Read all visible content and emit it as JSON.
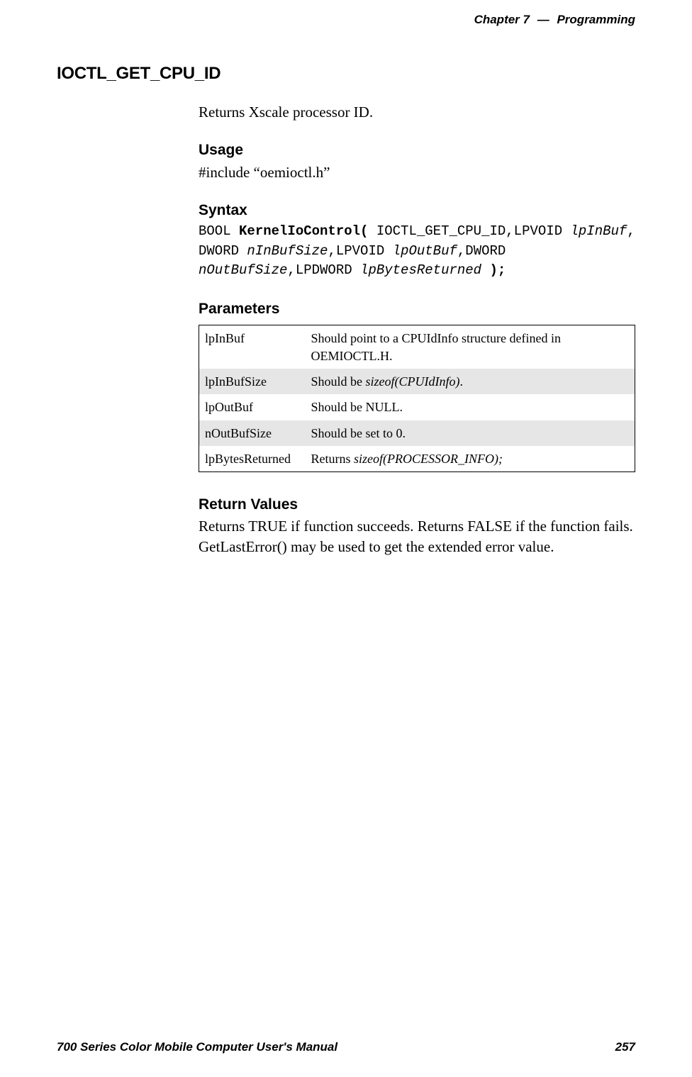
{
  "header": {
    "chapter_label": "Chapter",
    "chapter_number": "7",
    "separator": "—",
    "chapter_title": "Programming"
  },
  "section": {
    "title": "IOCTL_GET_CPU_ID",
    "intro": "Returns Xscale processor ID."
  },
  "usage": {
    "heading": "Usage",
    "text": "#include “oemioctl.h”"
  },
  "syntax": {
    "heading": "Syntax",
    "tokens": {
      "t1": "BOOL ",
      "t2": "KernelIoControl(",
      "t3": " IOCTL_GET_CPU_ID,LPVOID ",
      "t4": "lpInBuf",
      "t5": ", DWORD ",
      "t6": "nInBufSize",
      "t7": ",LPVOID ",
      "t8": "lpOutBuf",
      "t9": ",DWORD ",
      "t10": "nOutBufSize",
      "t11": ",LPDWORD ",
      "t12": "lpBytesReturned",
      "t13": " );"
    }
  },
  "parameters": {
    "heading": "Parameters",
    "rows": [
      {
        "name": "lpInBuf",
        "desc_pre": "Should point to a CPUIdInfo structure defined in OEMIOCTL.H.",
        "desc_it": "",
        "desc_post": ""
      },
      {
        "name": "lpInBufSize",
        "desc_pre": "Should be ",
        "desc_it": "sizeof(CPUIdInfo)",
        "desc_post": "."
      },
      {
        "name": "lpOutBuf",
        "desc_pre": "Should be NULL.",
        "desc_it": "",
        "desc_post": ""
      },
      {
        "name": "nOutBufSize",
        "desc_pre": "Should be set to 0.",
        "desc_it": "",
        "desc_post": ""
      },
      {
        "name": "lpBytesReturned",
        "desc_pre": "Returns ",
        "desc_it": "sizeof(PROCESSOR_INFO);",
        "desc_post": ""
      }
    ]
  },
  "return_values": {
    "heading": "Return Values",
    "body": "Returns TRUE if function succeeds. Returns FALSE if the function fails. GetLastError() may be used to get the extended error value."
  },
  "footer": {
    "manual_title": "700 Series Color Mobile Computer User's Manual",
    "page_number": "257"
  }
}
